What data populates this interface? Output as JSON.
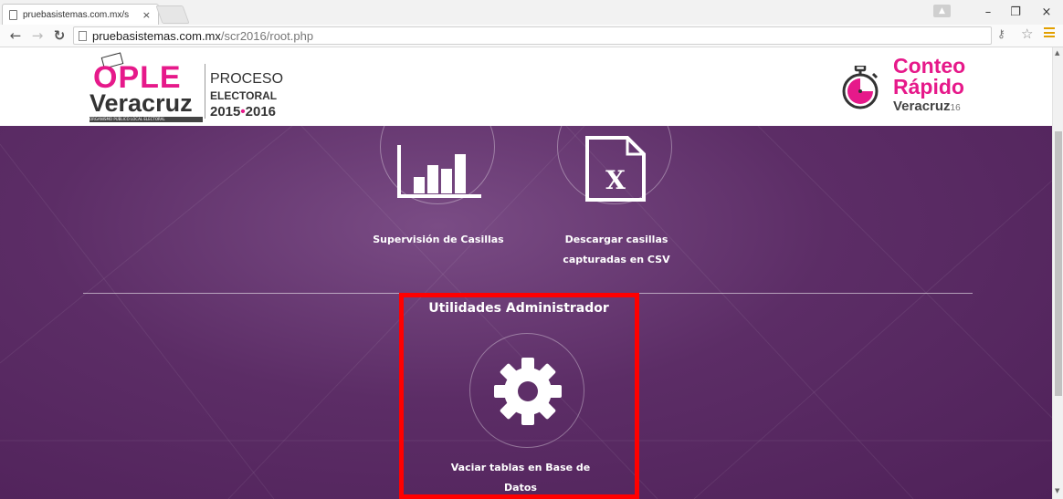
{
  "browser": {
    "tab_title": "pruebasistemas.com.mx/s",
    "tab_close": "×",
    "url_host": "pruebasistemas.com.mx",
    "url_path": "/scr2016/root.php",
    "window_minimize": "–",
    "window_restore": "❐",
    "window_close": "×"
  },
  "header": {
    "ople_logo": "OPLE",
    "ople_veracruz": "Veracruz",
    "ople_subtitle": "ORGANISMO PÚBLICO LOCAL ELECTORAL",
    "proceso": "PROCESO",
    "electoral": "ELECTORAL",
    "year_start": "2015",
    "year_sep": "•",
    "year_end": "2016",
    "conteo_line1": "Conteo",
    "conteo_line2": "Rápido",
    "conteo_line3": "Veracruz",
    "conteo_suffix": "16"
  },
  "tiles": {
    "supervision_label": "Supervisión de Casillas",
    "descargar_label_line1": "Descargar casillas",
    "descargar_label_line2": "capturadas en CSV",
    "descargar_icon_letter": "X"
  },
  "admin": {
    "section_title": "Utilidades Administrador",
    "vaciar_label_line1": "Vaciar tablas en Base de",
    "vaciar_label_line2": "Datos"
  },
  "colors": {
    "brand_pink": "#e6198a",
    "purple_bg": "#5c2d66",
    "highlight_red": "#ff0000"
  }
}
